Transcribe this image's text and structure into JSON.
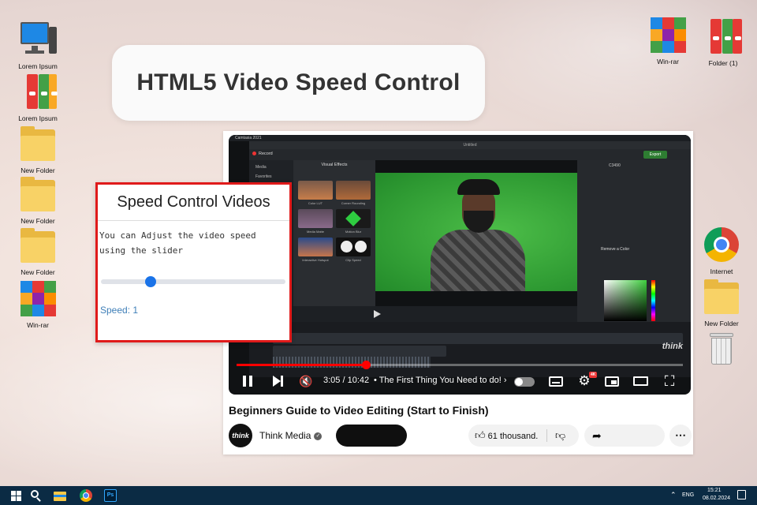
{
  "desktop": {
    "left_icons": [
      {
        "label": "Lorem Ipsum",
        "type": "computer"
      },
      {
        "label": "Lorem Ipsum",
        "type": "binder"
      },
      {
        "label": "New Folder",
        "type": "folder"
      },
      {
        "label": "New Folder",
        "type": "folder"
      },
      {
        "label": "New Folder",
        "type": "folder"
      },
      {
        "label": "Win-rar",
        "type": "winrar"
      }
    ],
    "right_icons": [
      {
        "label": "Win-rar",
        "type": "winrar"
      },
      {
        "label": "Folder (1)",
        "type": "binder"
      },
      {
        "label": "Internet",
        "type": "chrome"
      },
      {
        "label": "New Folder",
        "type": "folder"
      },
      {
        "label": "",
        "type": "recycle-bin"
      }
    ]
  },
  "title_card": {
    "text": "HTML5 Video Speed Control"
  },
  "speed_panel": {
    "heading": "Speed Control Videos",
    "description": "You can Adjust the video speed using the slider",
    "slider_value": 0.27,
    "speed_label": "Speed: 1"
  },
  "video": {
    "app_title": "Camtasia 2021",
    "window_title": "Untitled",
    "record_label": "Record",
    "export_label": "Export",
    "effects_heading": "Visual Effects",
    "effects": [
      "Color LUT",
      "Corner Rounding",
      "Media Matte",
      "Motion Blur",
      "Interactive Hotspot",
      "Clip Speed"
    ],
    "sidebar_items": [
      "Media",
      "Favorites"
    ],
    "right_panel_title": "Remove a Color",
    "right_panel_code": "C3490",
    "watermark": "think",
    "time": "3:05 / 10:42",
    "chapter": "• The First Thing You Need to do!",
    "progress": 0.29,
    "hd_badge": "4K"
  },
  "video_info": {
    "title": "Beginners Guide to Video Editing (Start to Finish)",
    "channel_avatar_text": "think",
    "channel_name": "Think Media",
    "likes": "61 thousand."
  },
  "taskbar": {
    "language": "ENG",
    "time": "15:21",
    "date": "08.02.2024"
  },
  "colors": {
    "accent_blue": "#1a73e8",
    "panel_border": "#e01a1a",
    "youtube_red": "#ff0000",
    "taskbar": "#0b2b44"
  }
}
